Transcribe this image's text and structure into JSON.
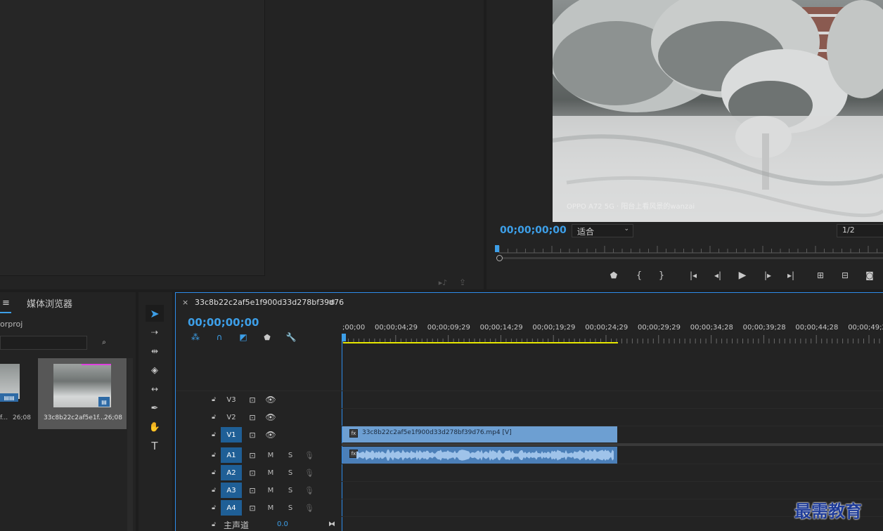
{
  "source_monitor": {},
  "program_monitor": {
    "timecode": "00;00;00;00",
    "fit_label": "适合",
    "resolution": "1/2",
    "video_caption": "OPPO A72 5G · 阳台上看风景的wanzai"
  },
  "project_panel": {
    "tab_menu_icon": "≡",
    "media_browser_tab": "媒体浏览器",
    "project_name_partial": "orproj",
    "items": [
      {
        "name": "f...",
        "duration": "26;08"
      },
      {
        "name": "33c8b22c2af5e1f...",
        "duration": "26;08"
      }
    ]
  },
  "timeline": {
    "sequence_name": "33c8b22c2af5e1f900d33d278bf39d76",
    "menu_icon": "≡",
    "timecode": "00;00;00;00",
    "ruler_labels": [
      ";00;00",
      "00;00;04;29",
      "00;00;09;29",
      "00;00;14;29",
      "00;00;19;29",
      "00;00;24;29",
      "00;00;29;29",
      "00;00;34;28",
      "00;00;39;28",
      "00;00;44;28",
      "00;00;49;2"
    ],
    "video_tracks": [
      "V3",
      "V2",
      "V1"
    ],
    "audio_tracks": [
      "A1",
      "A2",
      "A3",
      "A4"
    ],
    "mute_label": "M",
    "solo_label": "S",
    "master_label": "主声道",
    "master_value": "0.0",
    "video_clip_label": "33c8b22c2af5e1f900d33d278bf39d76.mp4 [V]"
  },
  "watermark": "最需教育",
  "colors": {
    "accent_blue": "#3d9fe8",
    "clip_video": "#6d9fd2",
    "clip_audio": "#4b7fb8",
    "work_area": "#e6e600"
  }
}
